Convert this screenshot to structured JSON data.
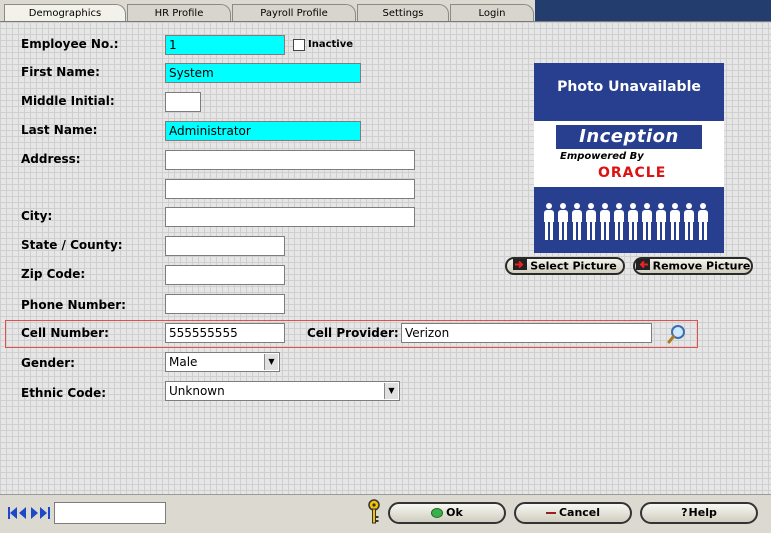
{
  "tabs": [
    {
      "label": "Demographics",
      "active": true
    },
    {
      "label": "HR Profile",
      "active": false
    },
    {
      "label": "Payroll Profile",
      "active": false
    },
    {
      "label": "Settings",
      "active": false
    },
    {
      "label": "Login",
      "active": false
    }
  ],
  "form": {
    "employee_no": {
      "label": "Employee No.:",
      "value": "1"
    },
    "inactive": {
      "label": "Inactive",
      "checked": false
    },
    "first_name": {
      "label": "First Name:",
      "value": "System"
    },
    "middle_initial": {
      "label": "Middle Initial:",
      "value": ""
    },
    "last_name": {
      "label": "Last Name:",
      "value": "Administrator"
    },
    "address": {
      "label": "Address:",
      "line1": "",
      "line2": ""
    },
    "city": {
      "label": "City:",
      "value": ""
    },
    "state": {
      "label": "State / County:",
      "value": ""
    },
    "zip": {
      "label": "Zip Code:",
      "value": ""
    },
    "phone": {
      "label": "Phone Number:",
      "value": ""
    },
    "cell": {
      "label": "Cell Number:",
      "value": "555555555"
    },
    "cell_provider": {
      "label": "Cell Provider:",
      "value": "Verizon"
    },
    "gender": {
      "label": "Gender:",
      "value": "Male"
    },
    "ethnic": {
      "label": "Ethnic Code:",
      "value": "Unknown"
    }
  },
  "photo": {
    "title": "Photo Unavailable",
    "logo_brand": "Inception",
    "logo_tagline": "Empowered By",
    "logo_partner": "ORACLE"
  },
  "photo_buttons": {
    "select": "Select Picture",
    "remove": "Remove Picture"
  },
  "footer": {
    "nav_value": "",
    "ok": "Ok",
    "cancel": "Cancel",
    "help": "Help"
  },
  "colors": {
    "highlight_field": "#00ffff",
    "frame": "#233d6f",
    "photo_bg": "#283f8f",
    "selection_box": "#e05050"
  }
}
